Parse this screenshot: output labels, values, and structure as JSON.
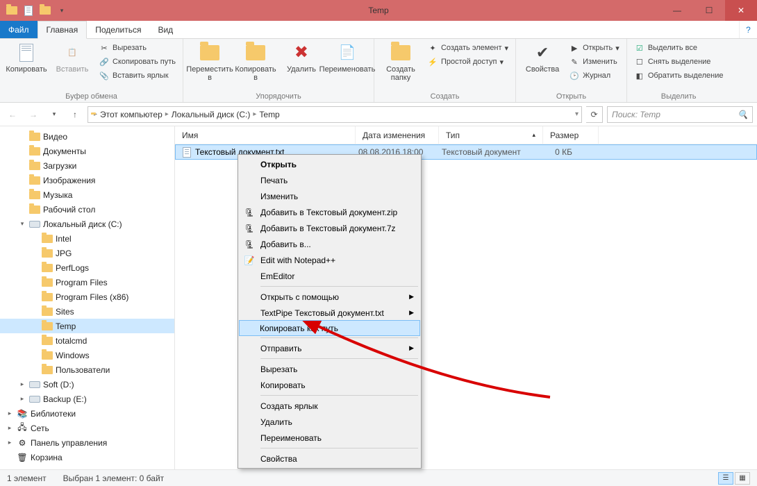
{
  "window": {
    "title": "Temp"
  },
  "tabs": {
    "file": "Файл",
    "home": "Главная",
    "share": "Поделиться",
    "view": "Вид"
  },
  "ribbon": {
    "clipboard": {
      "label": "Буфер обмена",
      "copy": "Копировать",
      "paste": "Вставить",
      "cut": "Вырезать",
      "copy_path": "Скопировать путь",
      "paste_shortcut": "Вставить ярлык"
    },
    "organize": {
      "label": "Упорядочить",
      "move_to": "Переместить в",
      "copy_to": "Копировать в",
      "delete": "Удалить",
      "rename": "Переименовать"
    },
    "new": {
      "label": "Создать",
      "new_folder": "Создать папку",
      "new_item": "Создать элемент",
      "easy_access": "Простой доступ"
    },
    "open": {
      "label": "Открыть",
      "properties": "Свойства",
      "open": "Открыть",
      "edit": "Изменить",
      "history": "Журнал"
    },
    "select": {
      "label": "Выделить",
      "select_all": "Выделить все",
      "select_none": "Снять выделение",
      "invert": "Обратить выделение"
    }
  },
  "breadcrumbs": [
    "Этот компьютер",
    "Локальный диск (C:)",
    "Temp"
  ],
  "search": {
    "placeholder": "Поиск: Temp"
  },
  "columns": {
    "name": "Имя",
    "date": "Дата изменения",
    "type": "Тип",
    "size": "Размер"
  },
  "file": {
    "name": "Текстовый документ.txt",
    "date": "08.08.2016 18:00",
    "type": "Текстовый документ",
    "size": "0 КБ"
  },
  "tree": [
    {
      "label": "Видео",
      "indent": 1,
      "icon": "folder"
    },
    {
      "label": "Документы",
      "indent": 1,
      "icon": "folder"
    },
    {
      "label": "Загрузки",
      "indent": 1,
      "icon": "folder"
    },
    {
      "label": "Изображения",
      "indent": 1,
      "icon": "folder"
    },
    {
      "label": "Музыка",
      "indent": 1,
      "icon": "folder"
    },
    {
      "label": "Рабочий стол",
      "indent": 1,
      "icon": "folder"
    },
    {
      "label": "Локальный диск (C:)",
      "indent": 1,
      "icon": "drive",
      "expand": "▾"
    },
    {
      "label": "Intel",
      "indent": 2,
      "icon": "folder"
    },
    {
      "label": "JPG",
      "indent": 2,
      "icon": "folder"
    },
    {
      "label": "PerfLogs",
      "indent": 2,
      "icon": "folder"
    },
    {
      "label": "Program Files",
      "indent": 2,
      "icon": "folder"
    },
    {
      "label": "Program Files (x86)",
      "indent": 2,
      "icon": "folder"
    },
    {
      "label": "Sites",
      "indent": 2,
      "icon": "folder"
    },
    {
      "label": "Temp",
      "indent": 2,
      "icon": "folder",
      "selected": true
    },
    {
      "label": "totalcmd",
      "indent": 2,
      "icon": "folder"
    },
    {
      "label": "Windows",
      "indent": 2,
      "icon": "folder"
    },
    {
      "label": "Пользователи",
      "indent": 2,
      "icon": "folder"
    },
    {
      "label": "Soft (D:)",
      "indent": 1,
      "icon": "drive",
      "expand": "▸"
    },
    {
      "label": "Backup (E:)",
      "indent": 1,
      "icon": "drive",
      "expand": "▸"
    },
    {
      "label": "Библиотеки",
      "indent": 0,
      "icon": "lib",
      "expand": "▸"
    },
    {
      "label": "Сеть",
      "indent": 0,
      "icon": "net",
      "expand": "▸"
    },
    {
      "label": "Панель управления",
      "indent": 0,
      "icon": "cpl",
      "expand": "▸"
    },
    {
      "label": "Корзина",
      "indent": 0,
      "icon": "bin"
    }
  ],
  "context_menu": [
    {
      "label": "Открыть",
      "bold": true
    },
    {
      "label": "Печать"
    },
    {
      "label": "Изменить"
    },
    {
      "label": "Добавить в Текстовый документ.zip",
      "icon": "arc"
    },
    {
      "label": "Добавить в Текстовый документ.7z",
      "icon": "arc"
    },
    {
      "label": "Добавить в...",
      "icon": "arc"
    },
    {
      "label": "Edit with Notepad++",
      "icon": "npp"
    },
    {
      "label": "EmEditor"
    },
    {
      "type": "sep"
    },
    {
      "label": "Открыть с помощью",
      "submenu": true
    },
    {
      "label": "TextPipe Текстовый документ.txt",
      "submenu": true
    },
    {
      "label": "Копировать как путь",
      "highlight": true
    },
    {
      "type": "sep"
    },
    {
      "label": "Отправить",
      "submenu": true
    },
    {
      "type": "sep"
    },
    {
      "label": "Вырезать"
    },
    {
      "label": "Копировать"
    },
    {
      "type": "sep"
    },
    {
      "label": "Создать ярлык"
    },
    {
      "label": "Удалить"
    },
    {
      "label": "Переименовать"
    },
    {
      "type": "sep"
    },
    {
      "label": "Свойства"
    }
  ],
  "status": {
    "count": "1 элемент",
    "selection": "Выбран 1 элемент: 0 байт"
  }
}
